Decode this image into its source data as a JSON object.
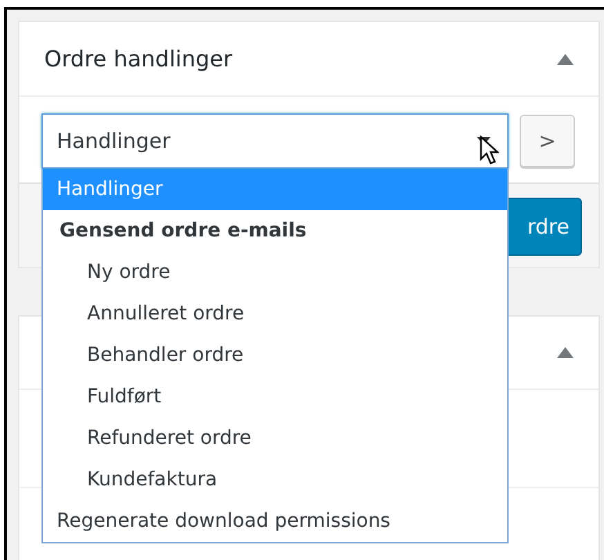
{
  "panel": {
    "title": "Ordre handlinger",
    "collapsed": false
  },
  "actions": {
    "value": "Handlinger",
    "open": true,
    "go_label": ">",
    "submit_label": "rdre",
    "options": [
      {
        "label": "Handlinger",
        "kind": "option",
        "selected": true
      },
      {
        "label": "Gensend ordre e-mails",
        "kind": "group",
        "children": [
          {
            "label": "Ny ordre",
            "selected": false
          },
          {
            "label": "Annulleret ordre",
            "selected": false
          },
          {
            "label": "Behandler ordre",
            "selected": false
          },
          {
            "label": "Fuldført",
            "selected": false
          },
          {
            "label": "Refunderet ordre",
            "selected": false
          },
          {
            "label": "Kundefaktura",
            "selected": false
          }
        ]
      },
      {
        "label": "Regenerate download permissions",
        "kind": "option",
        "selected": false
      }
    ]
  },
  "panel_2": {
    "collapsed": false
  }
}
